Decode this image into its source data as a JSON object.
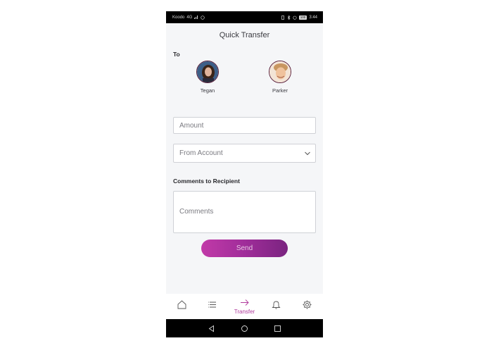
{
  "status_bar": {
    "carrier": "Koodo",
    "network": "4G",
    "battery": "100",
    "time": "3:44"
  },
  "header": {
    "title": "Quick Transfer"
  },
  "recipients": {
    "label": "To",
    "items": [
      {
        "name": "Tegan"
      },
      {
        "name": "Parker"
      }
    ]
  },
  "form": {
    "amount_placeholder": "Amount",
    "account_selected": "From Account",
    "comments_label": "Comments to Recipient",
    "comments_placeholder": "Comments",
    "send_label": "Send"
  },
  "bottom_nav": {
    "items": [
      {
        "icon": "home-icon",
        "label": ""
      },
      {
        "icon": "list-icon",
        "label": ""
      },
      {
        "icon": "arrow-right-icon",
        "label": "Transfer",
        "active": true
      },
      {
        "icon": "bell-icon",
        "label": ""
      },
      {
        "icon": "gear-icon",
        "label": ""
      }
    ]
  },
  "colors": {
    "accent": "#b03a9c",
    "button_start": "#c13aa8",
    "button_end": "#7a2480",
    "background": "#f5f6f8"
  }
}
